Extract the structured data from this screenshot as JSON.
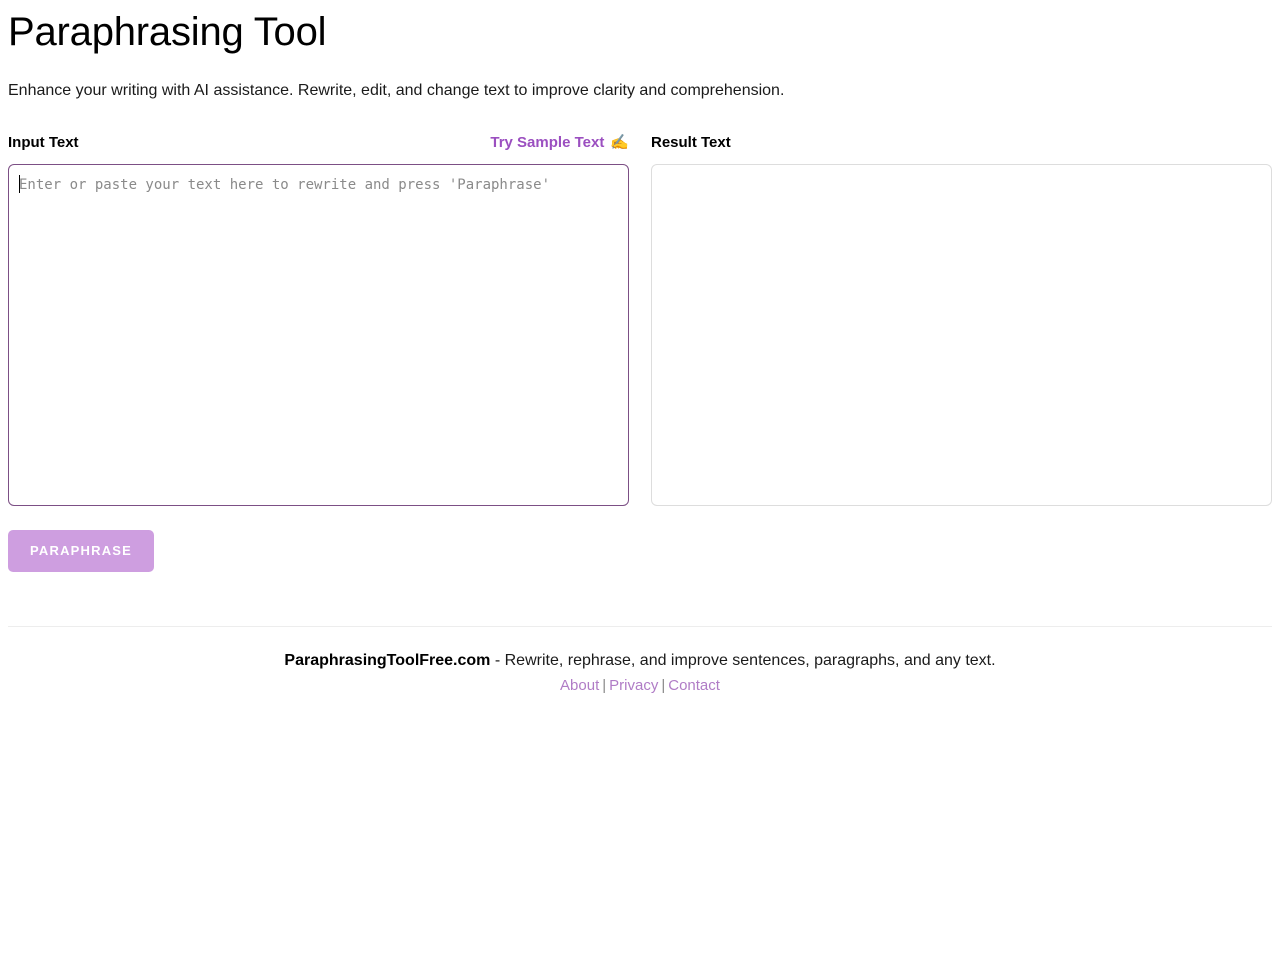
{
  "header": {
    "title": "Paraphrasing Tool",
    "subtitle": "Enhance your writing with AI assistance. Rewrite, edit, and change text to improve clarity and comprehension."
  },
  "input_panel": {
    "label": "Input Text",
    "sample_link_label": "Try Sample Text",
    "sample_link_icon": "writing-hand-emoji",
    "sample_link_glyph": "✍️",
    "placeholder": "Enter or paste your text here to rewrite and press 'Paraphrase'",
    "value": "",
    "focused": true
  },
  "result_panel": {
    "label": "Result Text",
    "placeholder": "",
    "value": ""
  },
  "actions": {
    "paraphrase_label": "PARAPHRASE",
    "paraphrase_disabled": true
  },
  "footer": {
    "brand": "ParaphrasingToolFree.com",
    "tagline": " - Rewrite, rephrase, and improve sentences, paragraphs, and any text.",
    "links": [
      {
        "label": "About"
      },
      {
        "label": "Privacy"
      },
      {
        "label": "Contact"
      }
    ],
    "separator": "|"
  },
  "colors": {
    "accent_purple": "#9b4fc0",
    "link_purple": "#b07cc6",
    "button_purple": "#ce9ee0",
    "input_border": "#7c4f85",
    "result_border": "#dddddd",
    "divider": "#ededed"
  }
}
